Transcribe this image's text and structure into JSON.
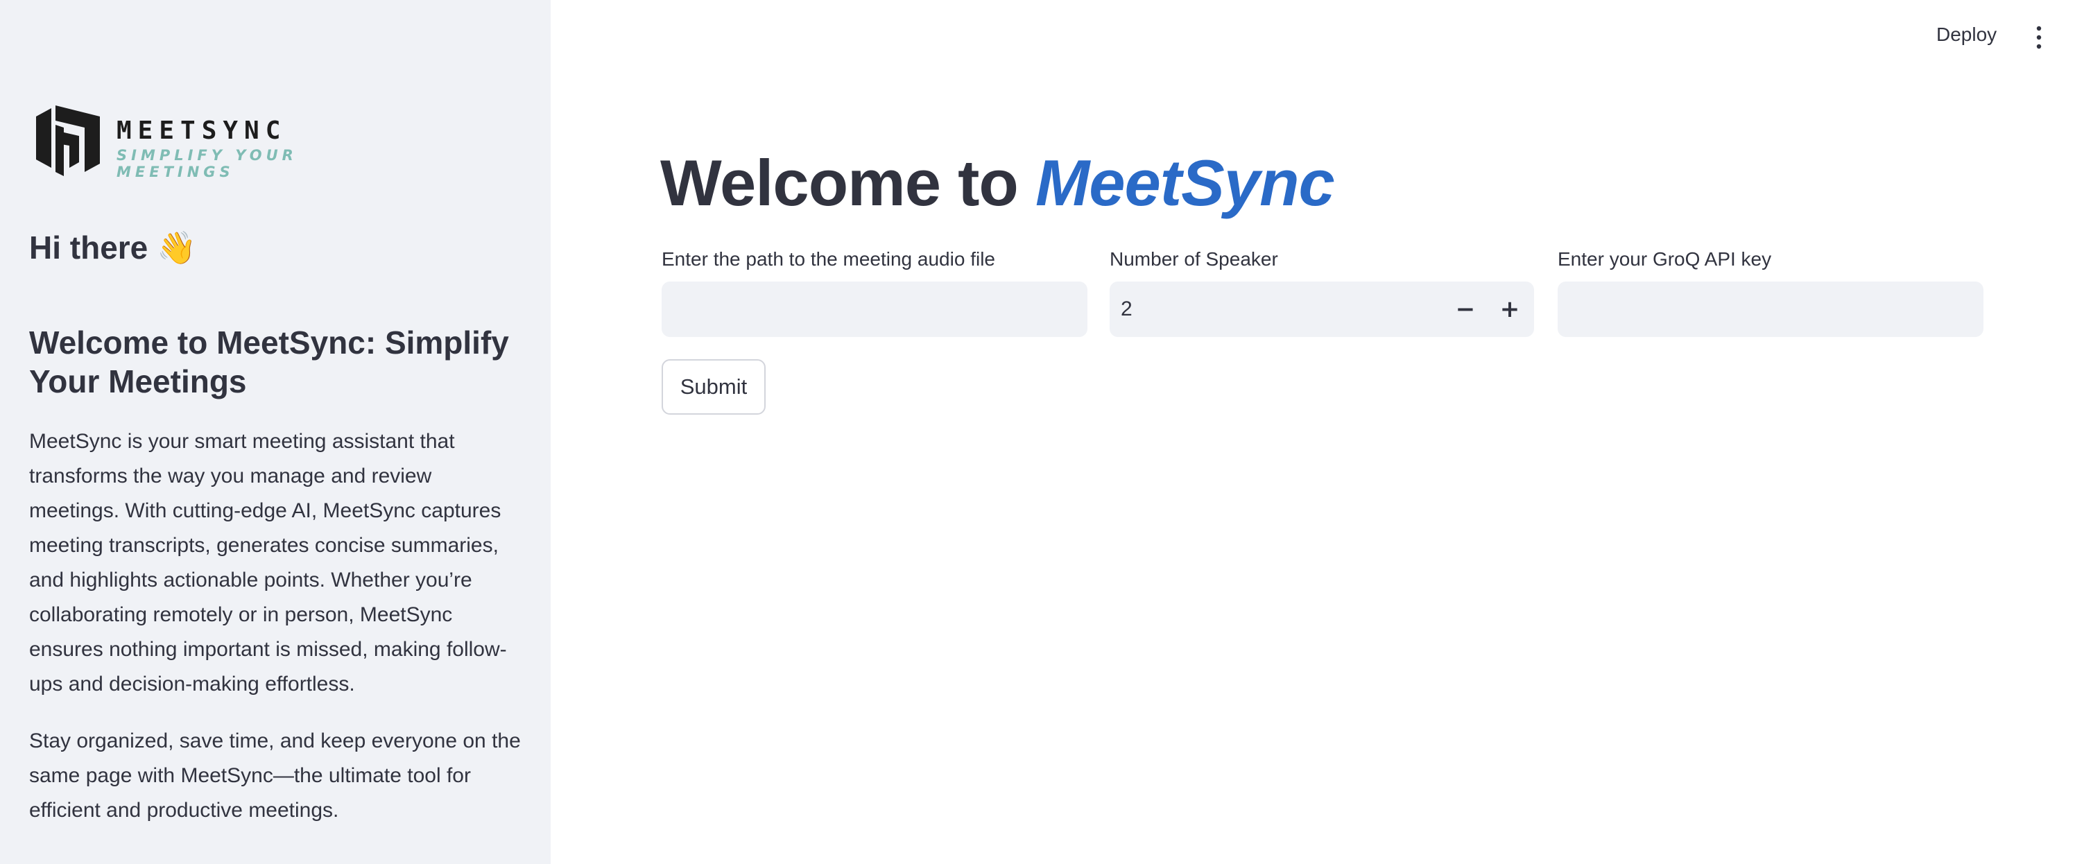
{
  "header": {
    "deploy_label": "Deploy",
    "menu_icon": "vertical-ellipsis-icon"
  },
  "sidebar": {
    "logo": {
      "name": "MEETSYNC",
      "tagline": "SIMPLIFY YOUR MEETINGS",
      "tagline_color": "#7fbcb4"
    },
    "greeting": "Hi there 👋",
    "heading": "Welcome to MeetSync: Simplify Your Meetings",
    "paragraph1": "MeetSync is your smart meeting assistant that transforms the way you manage and review meetings. With cutting-edge AI, MeetSync captures meeting transcripts, generates concise summaries, and highlights actionable points. Whether you’re collaborating remotely or in person, MeetSync ensures nothing important is missed, making follow-ups and decision-making effortless.",
    "paragraph2": "Stay organized, save time, and keep everyone on the same page with MeetSync—the ultimate tool for efficient and productive meetings."
  },
  "main": {
    "title_prefix": "Welcome to ",
    "title_brand": "MeetSync",
    "brand_color": "#2a6ac7",
    "fields": {
      "audio_path": {
        "label": "Enter the path to the meeting audio file",
        "value": ""
      },
      "speakers": {
        "label": "Number of Speaker",
        "value": "2",
        "decrement": "−",
        "increment": "+"
      },
      "api_key": {
        "label": "Enter your GroQ API key",
        "value": ""
      }
    },
    "submit_label": "Submit"
  }
}
